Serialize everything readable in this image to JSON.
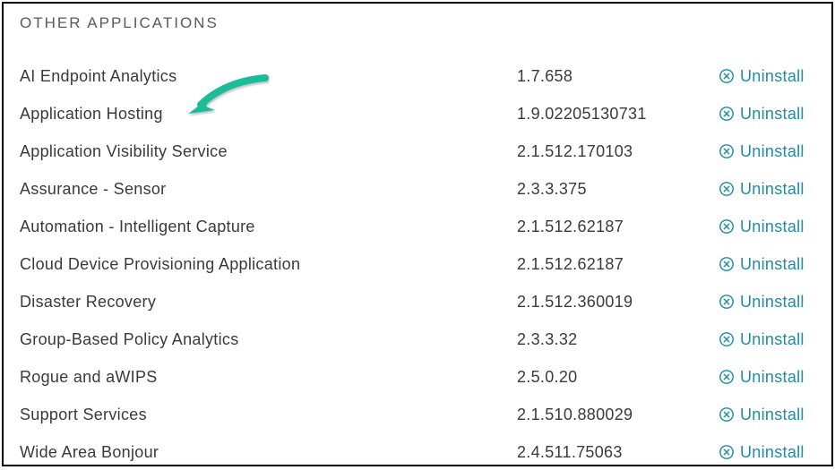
{
  "section_title": "OTHER APPLICATIONS",
  "uninstall_label": "Uninstall",
  "colors": {
    "link": "#1f8ca3",
    "arrow": "#1bbc9b",
    "text": "#3a3a3a",
    "header": "#5a5a5a"
  },
  "applications": [
    {
      "name": "AI Endpoint Analytics",
      "version": "1.7.658"
    },
    {
      "name": "Application Hosting",
      "version": "1.9.02205130731"
    },
    {
      "name": "Application Visibility Service",
      "version": "2.1.512.170103"
    },
    {
      "name": "Assurance - Sensor",
      "version": "2.3.3.375"
    },
    {
      "name": "Automation - Intelligent Capture",
      "version": "2.1.512.62187"
    },
    {
      "name": "Cloud Device Provisioning Application",
      "version": "2.1.512.62187"
    },
    {
      "name": "Disaster Recovery",
      "version": "2.1.512.360019"
    },
    {
      "name": "Group-Based Policy Analytics",
      "version": "2.3.3.32"
    },
    {
      "name": "Rogue and aWIPS",
      "version": "2.5.0.20"
    },
    {
      "name": "Support Services",
      "version": "2.1.510.880029"
    },
    {
      "name": "Wide Area Bonjour",
      "version": "2.4.511.75063"
    }
  ],
  "annotation": {
    "type": "arrow",
    "points_to": "Application Hosting"
  }
}
